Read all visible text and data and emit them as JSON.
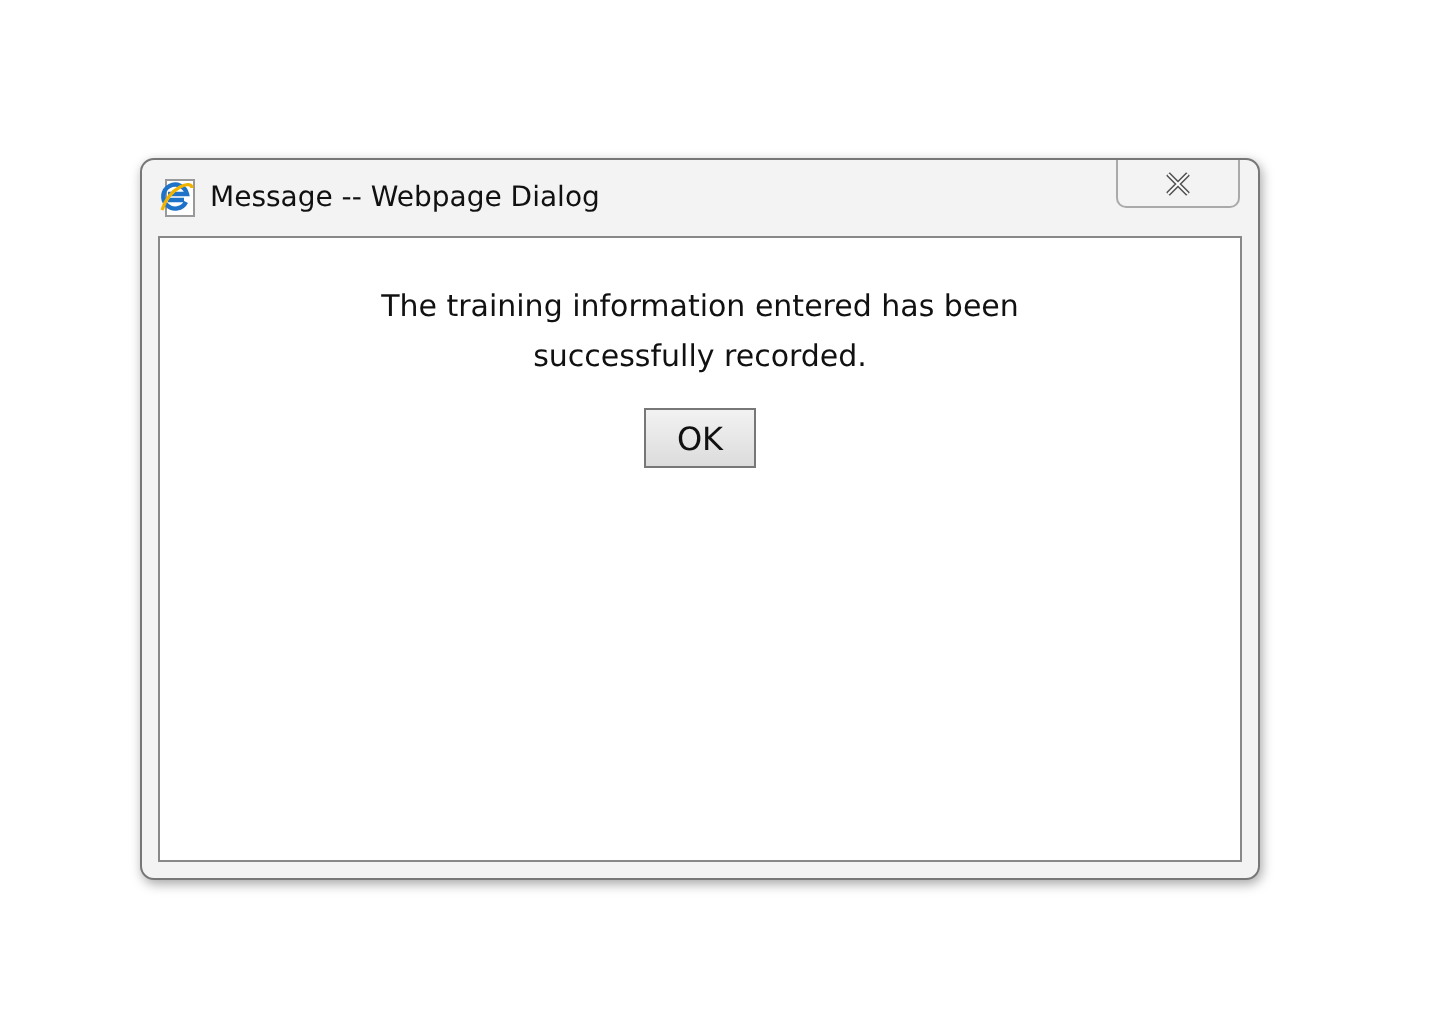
{
  "window": {
    "title": "Message -- Webpage Dialog"
  },
  "message": "The training information entered has been successfully recorded.",
  "buttons": [
    "OK"
  ]
}
